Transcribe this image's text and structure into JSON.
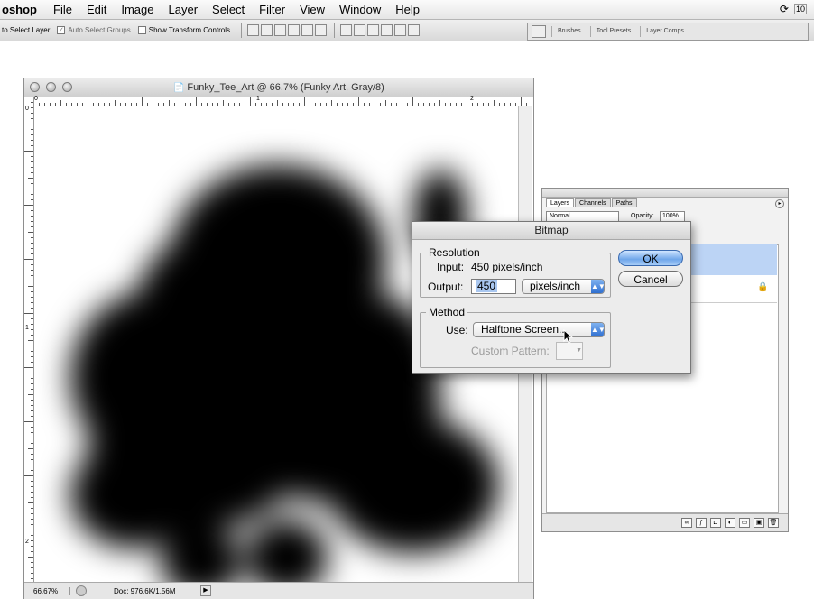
{
  "menubar": {
    "app": "oshop",
    "items": [
      "File",
      "Edit",
      "Image",
      "Layer",
      "Select",
      "Filter",
      "View",
      "Window",
      "Help"
    ],
    "clock": "10"
  },
  "options_bar": {
    "auto_select_layer": "to Select Layer",
    "auto_select_groups": "Auto Select Groups",
    "show_transform_controls": "Show Transform Controls",
    "palette_tabs": [
      "Brushes",
      "Tool Presets",
      "Layer Comps"
    ]
  },
  "document": {
    "title": "Funky_Tee_Art @ 66.7% (Funky Art, Gray/8)",
    "ruler_h_labels": [
      "0",
      "1",
      "2"
    ],
    "ruler_v_labels": [
      "0",
      "1",
      "2"
    ],
    "zoom": "66.67%",
    "doc_size": "Doc: 976.6K/1.56M"
  },
  "layers_palette": {
    "tabs": [
      "Layers",
      "Channels",
      "Paths"
    ],
    "blend_mode": "Normal",
    "opacity_label": "Opacity:",
    "opacity_value": "100%"
  },
  "dialog": {
    "title": "Bitmap",
    "resolution_label": "Resolution",
    "input_label": "Input:",
    "input_value": "450 pixels/inch",
    "output_label": "Output:",
    "output_value": "450",
    "output_unit": "pixels/inch",
    "method_label": "Method",
    "use_label": "Use:",
    "use_value": "Halftone Screen...",
    "custom_pattern_label": "Custom Pattern:",
    "ok_label": "OK",
    "cancel_label": "Cancel"
  }
}
